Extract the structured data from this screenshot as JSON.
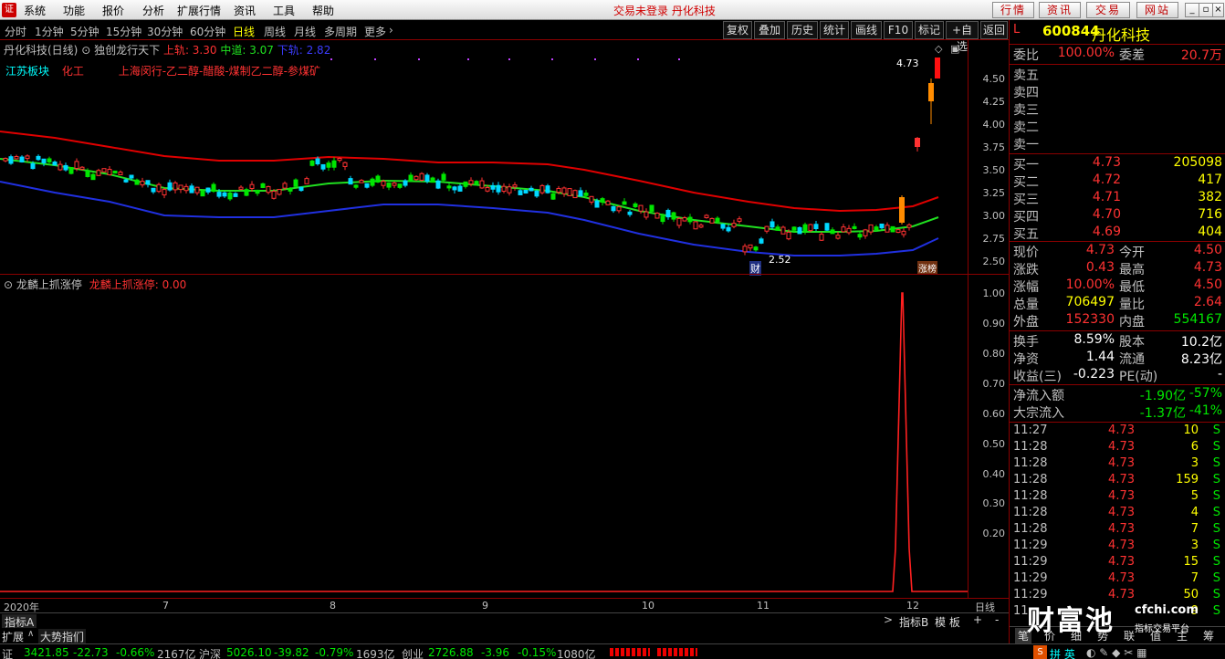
{
  "menubar": {
    "items": [
      "系统",
      "功能",
      "报价",
      "分析",
      "扩展行情",
      "资讯",
      "工具",
      "帮助"
    ],
    "status": "交易未登录 丹化科技",
    "buttons": [
      "行情",
      "资讯",
      "交易",
      "网站"
    ],
    "window_controls": [
      "minimize-icon",
      "restore-icon",
      "close-icon"
    ]
  },
  "periodbar": {
    "periods": [
      "分时",
      "1分钟",
      "5分钟",
      "15分钟",
      "30分钟",
      "60分钟",
      "日线",
      "周线",
      "月线",
      "多周期",
      "更多"
    ],
    "active": "日线",
    "tools": [
      "复权",
      "叠加",
      "历史",
      "统计",
      "画线",
      "F10",
      "标记",
      "+自选",
      "返回"
    ]
  },
  "main_legend": {
    "stock": "丹化科技(日线)",
    "indicator": "独创龙行天下",
    "upper": "上轨: 3.30",
    "middle": "中道: 3.07",
    "lower": "下轨: 2.82",
    "sector1": "江苏板块",
    "sector2": "化工",
    "concept": "上海闵行-乙二醇-醋酸-煤制乙二醇-参煤矿",
    "high_label": "4.73",
    "low_label": "2.52",
    "badge_cai": "财",
    "badge_end": "涨榜"
  },
  "main_yaxis": [
    "4.50",
    "4.25",
    "4.00",
    "3.75",
    "3.50",
    "3.25",
    "3.00",
    "2.75",
    "2.50"
  ],
  "sub_legend": {
    "name": "龙麟上抓涨停",
    "value": "龙麟上抓涨停: 0.00"
  },
  "sub_yaxis": [
    "1.00",
    "0.90",
    "0.80",
    "0.70",
    "0.60",
    "0.50",
    "0.40",
    "0.30",
    "0.20"
  ],
  "time_axis": [
    "2020年",
    "7",
    "8",
    "9",
    "10",
    "11",
    "12",
    "日线"
  ],
  "tabs": {
    "indicator_a": "指标A",
    "expand": "扩展",
    "market": "大势指们",
    "indicator_b": "指标B",
    "template": "模 板",
    "plus": "+",
    "minus": "-"
  },
  "quote": {
    "code": "600844",
    "name": "丹化科技",
    "tag": "L",
    "weibi_label": "委比",
    "weibi": "100.00%",
    "weicha_label": "委差",
    "weicha": "20.7万",
    "asks": [
      {
        "label": "卖五",
        "price": "",
        "vol": ""
      },
      {
        "label": "卖四",
        "price": "",
        "vol": ""
      },
      {
        "label": "卖三",
        "price": "",
        "vol": ""
      },
      {
        "label": "卖二",
        "price": "",
        "vol": ""
      },
      {
        "label": "卖一",
        "price": "",
        "vol": ""
      }
    ],
    "bids": [
      {
        "label": "买一",
        "price": "4.73",
        "vol": "205098"
      },
      {
        "label": "买二",
        "price": "4.72",
        "vol": "417"
      },
      {
        "label": "买三",
        "price": "4.71",
        "vol": "382"
      },
      {
        "label": "买四",
        "price": "4.70",
        "vol": "716"
      },
      {
        "label": "买五",
        "price": "4.69",
        "vol": "404"
      }
    ],
    "stats": [
      {
        "l1": "现价",
        "v1": "4.73",
        "c1": "red",
        "l2": "今开",
        "v2": "4.50",
        "c2": "red"
      },
      {
        "l1": "涨跌",
        "v1": "0.43",
        "c1": "red",
        "l2": "最高",
        "v2": "4.73",
        "c2": "red"
      },
      {
        "l1": "涨幅",
        "v1": "10.00%",
        "c1": "red",
        "l2": "最低",
        "v2": "4.50",
        "c2": "red"
      },
      {
        "l1": "总量",
        "v1": "706497",
        "c1": "yellow",
        "l2": "量比",
        "v2": "2.64",
        "c2": "red"
      },
      {
        "l1": "外盘",
        "v1": "152330",
        "c1": "red",
        "l2": "内盘",
        "v2": "554167",
        "c2": "green"
      }
    ],
    "stats2": [
      {
        "l1": "换手",
        "v1": "8.59%",
        "l2": "股本",
        "v2": "10.2亿"
      },
      {
        "l1": "净资",
        "v1": "1.44",
        "l2": "流通",
        "v2": "8.23亿"
      },
      {
        "l1": "收益(三)",
        "v1": "-0.223",
        "l2": "PE(动)",
        "v2": "-"
      }
    ],
    "flows": [
      {
        "label": "净流入额",
        "value": "-1.90亿",
        "pct": "-57%"
      },
      {
        "label": "大宗流入",
        "value": "-1.37亿",
        "pct": "-41%"
      }
    ],
    "ticks": [
      {
        "t": "11:27",
        "p": "4.73",
        "v": "10",
        "s": "S"
      },
      {
        "t": "11:28",
        "p": "4.73",
        "v": "6",
        "s": "S"
      },
      {
        "t": "11:28",
        "p": "4.73",
        "v": "3",
        "s": "S"
      },
      {
        "t": "11:28",
        "p": "4.73",
        "v": "159",
        "s": "S"
      },
      {
        "t": "11:28",
        "p": "4.73",
        "v": "5",
        "s": "S"
      },
      {
        "t": "11:28",
        "p": "4.73",
        "v": "4",
        "s": "S"
      },
      {
        "t": "11:28",
        "p": "4.73",
        "v": "7",
        "s": "S"
      },
      {
        "t": "11:29",
        "p": "4.73",
        "v": "3",
        "s": "S"
      },
      {
        "t": "11:29",
        "p": "4.73",
        "v": "15",
        "s": "S"
      },
      {
        "t": "11:29",
        "p": "4.73",
        "v": "7",
        "s": "S"
      },
      {
        "t": "11:29",
        "p": "4.73",
        "v": "50",
        "s": "S"
      },
      {
        "t": "11",
        "p": "",
        "v": "9",
        "s": "S"
      }
    ],
    "bottom_tabs": [
      "笔",
      "价",
      "细",
      "势",
      "联",
      "值",
      "主",
      "筹"
    ]
  },
  "statusbar": {
    "sh_label": "证",
    "sh_index": "3421.85",
    "sh_chg": "-22.73",
    "sh_pct": "-0.66%",
    "sh_amt": "2167亿",
    "sz_label": "沪深",
    "sz_index": "5026.10",
    "sz_chg": "-39.82",
    "sz_pct": "-0.79%",
    "sz_amt": "1693亿",
    "cy_label": "创业",
    "cy_index": "2726.88",
    "cy_chg": "-3.96",
    "cy_pct": "-0.15%",
    "cy_amt": "1080亿",
    "tray": "拼 英"
  },
  "watermark": {
    "brand": "财富池",
    "site": "cfchi.com",
    "slogan": "指标交易平台"
  },
  "colors": {
    "up": "#ff3232",
    "down": "#00e600",
    "upper_band": "#e00000",
    "middle_band": "#20e020",
    "lower_band": "#2020e0",
    "grid": "#8b0000"
  }
}
